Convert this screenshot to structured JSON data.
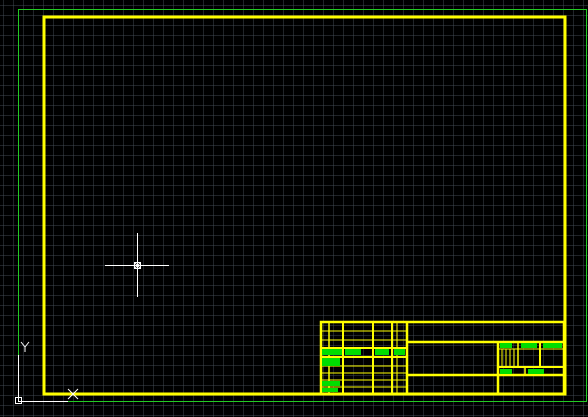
{
  "viewport": {
    "background": "#000000",
    "grid_color": "#46505a"
  },
  "colors": {
    "limits": "#22cc22",
    "border": "#ffff00",
    "fill": "#00dd00",
    "crosshair": "#ffffff",
    "ucs": "#ffffff"
  },
  "ucs": {
    "y_axis_label": "Y",
    "x_axis_label": "X"
  },
  "cursor": {
    "type": "crosshair",
    "icon": "crosshair-pickbox-icon"
  }
}
